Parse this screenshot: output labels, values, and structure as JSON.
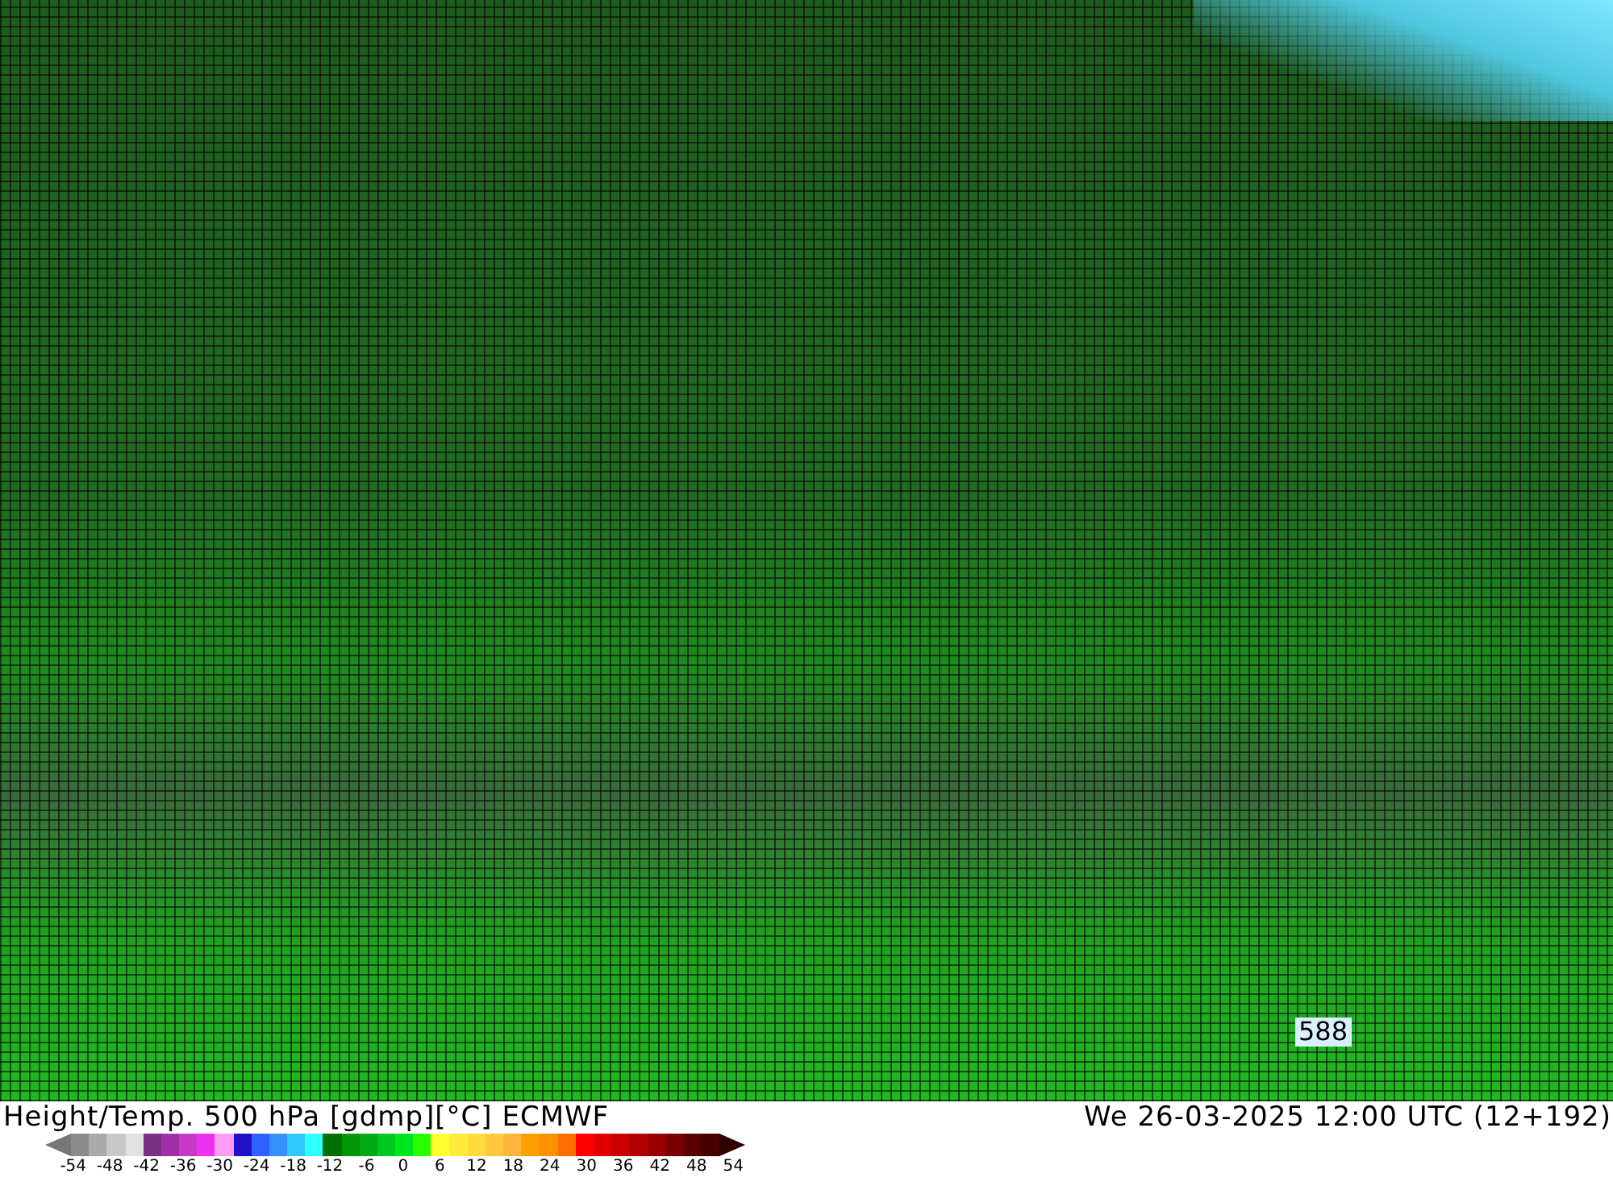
{
  "map": {
    "label": "588"
  },
  "title": "Height/Temp. 500 hPa [gdmp][°C] ECMWF",
  "valid_time": "We 26-03-2025 12:00 UTC (12+192)",
  "colorbar": {
    "swatches": [
      {
        "color": "#8c8c8c"
      },
      {
        "color": "#aaaaaa"
      },
      {
        "color": "#c8c8c8"
      },
      {
        "color": "#e2e2e2"
      },
      {
        "color": "#7a3080"
      },
      {
        "color": "#a030a8"
      },
      {
        "color": "#c838c8"
      },
      {
        "color": "#f030f0"
      },
      {
        "color": "#ff9cf8"
      },
      {
        "color": "#2010c8"
      },
      {
        "color": "#3060ff"
      },
      {
        "color": "#3890ff"
      },
      {
        "color": "#30c8ff"
      },
      {
        "color": "#30ffff"
      },
      {
        "color": "#006e00"
      },
      {
        "color": "#00960a"
      },
      {
        "color": "#00aa14"
      },
      {
        "color": "#00c81e"
      },
      {
        "color": "#00e61e"
      },
      {
        "color": "#28ff00"
      },
      {
        "color": "#ffff30"
      },
      {
        "color": "#ffec3c"
      },
      {
        "color": "#ffdc3c"
      },
      {
        "color": "#ffc83c"
      },
      {
        "color": "#ffb43c"
      },
      {
        "color": "#ffa000"
      },
      {
        "color": "#ff9000"
      },
      {
        "color": "#ff6e00"
      },
      {
        "color": "#ff0000"
      },
      {
        "color": "#e00000"
      },
      {
        "color": "#c80000"
      },
      {
        "color": "#b00000"
      },
      {
        "color": "#960000"
      },
      {
        "color": "#7a0000"
      },
      {
        "color": "#5a0000"
      },
      {
        "color": "#460000"
      }
    ],
    "ticks": [
      "-54",
      "-48",
      "-42",
      "-36",
      "-30",
      "-24",
      "-18",
      "-12",
      "-6",
      "0",
      "6",
      "12",
      "18",
      "24",
      "30",
      "36",
      "42",
      "48",
      "54"
    ]
  }
}
